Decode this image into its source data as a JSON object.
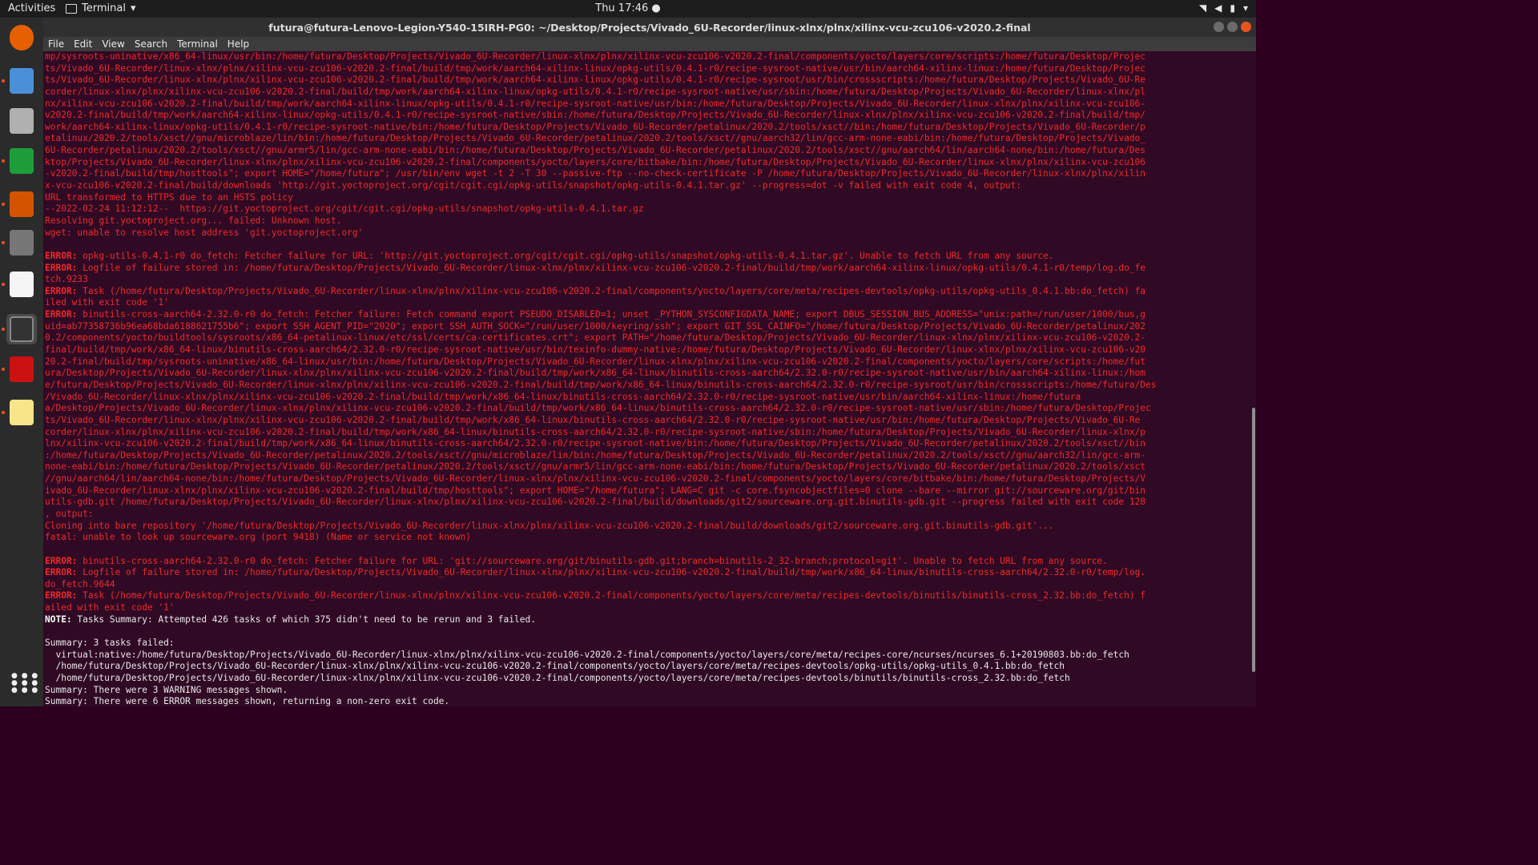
{
  "topbar": {
    "activities": "Activities",
    "app_name": "Terminal",
    "clock": "Thu 17:46"
  },
  "window": {
    "title": "futura@futura-Lenovo-Legion-Y540-15IRH-PG0: ~/Desktop/Projects/Vivado_6U-Recorder/linux-xlnx/plnx/xilinx-vcu-zcu106-v2020.2-final"
  },
  "menu": {
    "file": "File",
    "edit": "Edit",
    "view": "View",
    "search": "Search",
    "terminal": "Terminal",
    "help": "Help"
  },
  "dock": [
    {
      "name": "firefox-icon",
      "color": "#e66000"
    },
    {
      "name": "text-editor-icon",
      "color": "#4a90d9"
    },
    {
      "name": "files-icon",
      "color": "#b0b0b0"
    },
    {
      "name": "spreadsheet-icon",
      "color": "#1e9e3a"
    },
    {
      "name": "presentation-icon",
      "color": "#d35400"
    },
    {
      "name": "settings-icon",
      "color": "#777777"
    },
    {
      "name": "notes-icon",
      "color": "#f5f5f5"
    },
    {
      "name": "terminal-icon",
      "color": "#333333"
    },
    {
      "name": "evince-icon",
      "color": "#cc1111"
    },
    {
      "name": "sticky-notes-icon",
      "color": "#f7e58a"
    }
  ],
  "terminal": {
    "lines": [
      {
        "t": "mp/sysroots-uninative/x86_64-linux/usr/bin:/home/futura/Desktop/Projects/Vivado_6U-Recorder/linux-xlnx/plnx/xilinx-vcu-zcu106-v2020.2-final/components/yocto/layers/core/scripts:/home/futura/Desktop/Projec",
        "c": "red"
      },
      {
        "t": "ts/Vivado_6U-Recorder/linux-xlnx/plnx/xilinx-vcu-zcu106-v2020.2-final/build/tmp/work/aarch64-xilinx-linux/opkg-utils/0.4.1-r0/recipe-sysroot-native/usr/bin/aarch64-xilinx-linux:/home/futura/Desktop/Projec",
        "c": "red"
      },
      {
        "t": "ts/Vivado_6U-Recorder/linux-xlnx/plnx/xilinx-vcu-zcu106-v2020.2-final/build/tmp/work/aarch64-xilinx-linux/opkg-utils/0.4.1-r0/recipe-sysroot/usr/bin/crossscripts:/home/futura/Desktop/Projects/Vivado_6U-Re",
        "c": "red"
      },
      {
        "t": "corder/linux-xlnx/plnx/xilinx-vcu-zcu106-v2020.2-final/build/tmp/work/aarch64-xilinx-linux/opkg-utils/0.4.1-r0/recipe-sysroot-native/usr/sbin:/home/futura/Desktop/Projects/Vivado_6U-Recorder/linux-xlnx/pl",
        "c": "red"
      },
      {
        "t": "nx/xilinx-vcu-zcu106-v2020.2-final/build/tmp/work/aarch64-xilinx-linux/opkg-utils/0.4.1-r0/recipe-sysroot-native/usr/bin:/home/futura/Desktop/Projects/Vivado_6U-Recorder/linux-xlnx/plnx/xilinx-vcu-zcu106-",
        "c": "red"
      },
      {
        "t": "v2020.2-final/build/tmp/work/aarch64-xilinx-linux/opkg-utils/0.4.1-r0/recipe-sysroot-native/sbin:/home/futura/Desktop/Projects/Vivado_6U-Recorder/linux-xlnx/plnx/xilinx-vcu-zcu106-v2020.2-final/build/tmp/",
        "c": "red"
      },
      {
        "t": "work/aarch64-xilinx-linux/opkg-utils/0.4.1-r0/recipe-sysroot-native/bin:/home/futura/Desktop/Projects/Vivado_6U-Recorder/petalinux/2020.2/tools/xsct//bin:/home/futura/Desktop/Projects/Vivado_6U-Recorder/p",
        "c": "red"
      },
      {
        "t": "etalinux/2020.2/tools/xsct//gnu/microblaze/lin/bin:/home/futura/Desktop/Projects/Vivado_6U-Recorder/petalinux/2020.2/tools/xsct//gnu/aarch32/lin/gcc-arm-none-eabi/bin:/home/futura/Desktop/Projects/Vivado_",
        "c": "red"
      },
      {
        "t": "6U-Recorder/petalinux/2020.2/tools/xsct//gnu/armr5/lin/gcc-arm-none-eabi/bin:/home/futura/Desktop/Projects/Vivado_6U-Recorder/petalinux/2020.2/tools/xsct//gnu/aarch64/lin/aarch64-none/bin:/home/futura/Des",
        "c": "red"
      },
      {
        "t": "ktop/Projects/Vivado_6U-Recorder/linux-xlnx/plnx/xilinx-vcu-zcu106-v2020.2-final/components/yocto/layers/core/bitbake/bin:/home/futura/Desktop/Projects/Vivado_6U-Recorder/linux-xlnx/plnx/xilinx-vcu-zcu106",
        "c": "red"
      },
      {
        "t": "-v2020.2-final/build/tmp/hosttools\"; export HOME=\"/home/futura\"; /usr/bin/env wget -t 2 -T 30 --passive-ftp --no-check-certificate -P /home/futura/Desktop/Projects/Vivado_6U-Recorder/linux-xlnx/plnx/xilin",
        "c": "red"
      },
      {
        "t": "x-vcu-zcu106-v2020.2-final/build/downloads 'http://git.yoctoproject.org/cgit/cgit.cgi/opkg-utils/snapshot/opkg-utils-0.4.1.tar.gz' --progress=dot -v failed with exit code 4, output:",
        "c": "red"
      },
      {
        "t": "URL transformed to HTTPS due to an HSTS policy",
        "c": "red"
      },
      {
        "t": "--2022-02-24 11:12:12--  https://git.yoctoproject.org/cgit/cgit.cgi/opkg-utils/snapshot/opkg-utils-0.4.1.tar.gz",
        "c": "red"
      },
      {
        "t": "Resolving git.yoctoproject.org... failed: Unknown host.",
        "c": "red"
      },
      {
        "t": "wget: unable to resolve host address 'git.yoctoproject.org'",
        "c": "red"
      },
      {
        "t": "",
        "c": "red"
      },
      {
        "p": "ERROR:",
        "t": " opkg-utils-0.4.1-r0 do_fetch: Fetcher failure for URL: 'http://git.yoctoproject.org/cgit/cgit.cgi/opkg-utils/snapshot/opkg-utils-0.4.1.tar.gz'. Unable to fetch URL from any source.",
        "c": "red"
      },
      {
        "p": "ERROR:",
        "t": " Logfile of failure stored in: /home/futura/Desktop/Projects/Vivado_6U-Recorder/linux-xlnx/plnx/xilinx-vcu-zcu106-v2020.2-final/build/tmp/work/aarch64-xilinx-linux/opkg-utils/0.4.1-r0/temp/log.do_fe",
        "c": "red"
      },
      {
        "t": "tch.9233",
        "c": "red"
      },
      {
        "p": "ERROR:",
        "t": " Task (/home/futura/Desktop/Projects/Vivado_6U-Recorder/linux-xlnx/plnx/xilinx-vcu-zcu106-v2020.2-final/components/yocto/layers/core/meta/recipes-devtools/opkg-utils/opkg-utils_0.4.1.bb:do_fetch) fa",
        "c": "red"
      },
      {
        "t": "iled with exit code '1'",
        "c": "red"
      },
      {
        "p": "ERROR:",
        "t": " binutils-cross-aarch64-2.32.0-r0 do_fetch: Fetcher failure: Fetch command export PSEUDO_DISABLED=1; unset _PYTHON_SYSCONFIGDATA_NAME; export DBUS_SESSION_BUS_ADDRESS=\"unix:path=/run/user/1000/bus,g",
        "c": "red"
      },
      {
        "t": "uid=ab77358736b96ea68bda6188621755b6\"; export SSH_AGENT_PID=\"2020\"; export SSH_AUTH_SOCK=\"/run/user/1000/keyring/ssh\"; export GIT_SSL_CAINFO=\"/home/futura/Desktop/Projects/Vivado_6U-Recorder/petalinux/202",
        "c": "red"
      },
      {
        "t": "0.2/components/yocto/buildtools/sysroots/x86_64-petalinux-linux/etc/ssl/certs/ca-certificates.crt\"; export PATH=\"/home/futura/Desktop/Projects/Vivado_6U-Recorder/linux-xlnx/plnx/xilinx-vcu-zcu106-v2020.2-",
        "c": "red"
      },
      {
        "t": "final/build/tmp/work/x86_64-linux/binutils-cross-aarch64/2.32.0-r0/recipe-sysroot-native/usr/bin/texinfo-dummy-native:/home/futura/Desktop/Projects/Vivado_6U-Recorder/linux-xlnx/plnx/xilinx-vcu-zcu106-v20",
        "c": "red"
      },
      {
        "t": "20.2-final/build/tmp/sysroots-uninative/x86_64-linux/usr/bin:/home/futura/Desktop/Projects/Vivado_6U-Recorder/linux-xlnx/plnx/xilinx-vcu-zcu106-v2020.2-final/components/yocto/layers/core/scripts:/home/fut",
        "c": "red"
      },
      {
        "t": "ura/Desktop/Projects/Vivado_6U-Recorder/linux-xlnx/plnx/xilinx-vcu-zcu106-v2020.2-final/build/tmp/work/x86_64-linux/binutils-cross-aarch64/2.32.0-r0/recipe-sysroot-native/usr/bin/aarch64-xilinx-linux:/hom",
        "c": "red"
      },
      {
        "t": "e/futura/Desktop/Projects/Vivado_6U-Recorder/linux-xlnx/plnx/xilinx-vcu-zcu106-v2020.2-final/build/tmp/work/x86_64-linux/binutils-cross-aarch64/2.32.0-r0/recipe-sysroot/usr/bin/crossscripts:/home/futura/Des",
        "c": "red"
      },
      {
        "t": "/Vivado_6U-Recorder/linux-xlnx/plnx/xilinx-vcu-zcu106-v2020.2-final/build/tmp/work/x86_64-linux/binutils-cross-aarch64/2.32.0-r0/recipe-sysroot-native/usr/bin/aarch64-xilinx-linux:/home/futura",
        "c": "red"
      },
      {
        "t": "a/Desktop/Projects/Vivado_6U-Recorder/linux-xlnx/plnx/xilinx-vcu-zcu106-v2020.2-final/build/tmp/work/x86_64-linux/binutils-cross-aarch64/2.32.0-r0/recipe-sysroot-native/usr/sbin:/home/futura/Desktop/Projec",
        "c": "red"
      },
      {
        "t": "ts/Vivado_6U-Recorder/linux-xlnx/plnx/xilinx-vcu-zcu106-v2020.2-final/build/tmp/work/x86_64-linux/binutils-cross-aarch64/2.32.0-r0/recipe-sysroot-native/usr/bin:/home/futura/Desktop/Projects/Vivado_6U-Re",
        "c": "red"
      },
      {
        "t": "corder/linux-xlnx/plnx/xilinx-vcu-zcu106-v2020.2-final/build/tmp/work/x86_64-linux/binutils-cross-aarch64/2.32.0-r0/recipe-sysroot-native/sbin:/home/futura/Desktop/Projects/Vivado_6U-Recorder/linux-xlnx/p",
        "c": "red"
      },
      {
        "t": "lnx/xilinx-vcu-zcu106-v2020.2-final/build/tmp/work/x86_64-linux/binutils-cross-aarch64/2.32.0-r0/recipe-sysroot-native/bin:/home/futura/Desktop/Projects/Vivado_6U-Recorder/petalinux/2020.2/tools/xsct//bin",
        "c": "red"
      },
      {
        "t": ":/home/futura/Desktop/Projects/Vivado_6U-Recorder/petalinux/2020.2/tools/xsct//gnu/microblaze/lin/bin:/home/futura/Desktop/Projects/Vivado_6U-Recorder/petalinux/2020.2/tools/xsct//gnu/aarch32/lin/gcc-arm-",
        "c": "red"
      },
      {
        "t": "none-eabi/bin:/home/futura/Desktop/Projects/Vivado_6U-Recorder/petalinux/2020.2/tools/xsct//gnu/armr5/lin/gcc-arm-none-eabi/bin:/home/futura/Desktop/Projects/Vivado_6U-Recorder/petalinux/2020.2/tools/xsct",
        "c": "red"
      },
      {
        "t": "//gnu/aarch64/lin/aarch64-none/bin:/home/futura/Desktop/Projects/Vivado_6U-Recorder/linux-xlnx/plnx/xilinx-vcu-zcu106-v2020.2-final/components/yocto/layers/core/bitbake/bin:/home/futura/Desktop/Projects/V",
        "c": "red"
      },
      {
        "t": "ivado_6U-Recorder/linux-xlnx/plnx/xilinx-vcu-zcu106-v2020.2-final/build/tmp/hosttools\"; export HOME=\"/home/futura\"; LANG=C git -c core.fsyncobjectfiles=0 clone --bare --mirror git://sourceware.org/git/bin",
        "c": "red"
      },
      {
        "t": "utils-gdb.git /home/futura/Desktop/Projects/Vivado_6U-Recorder/linux-xlnx/plnx/xilinx-vcu-zcu106-v2020.2-final/build/downloads/git2/sourceware.org.git.binutils-gdb.git --progress failed with exit code 128",
        "c": "red"
      },
      {
        "t": ", output:",
        "c": "red"
      },
      {
        "t": "Cloning into bare repository '/home/futura/Desktop/Projects/Vivado_6U-Recorder/linux-xlnx/plnx/xilinx-vcu-zcu106-v2020.2-final/build/downloads/git2/sourceware.org.git.binutils-gdb.git'...",
        "c": "red"
      },
      {
        "t": "fatal: unable to look up sourceware.org (port 9418) (Name or service not known)",
        "c": "red"
      },
      {
        "t": "",
        "c": "red"
      },
      {
        "p": "ERROR:",
        "t": " binutils-cross-aarch64-2.32.0-r0 do_fetch: Fetcher failure for URL: 'git://sourceware.org/git/binutils-gdb.git;branch=binutils-2_32-branch;protocol=git'. Unable to fetch URL from any source.",
        "c": "red"
      },
      {
        "p": "ERROR:",
        "t": " Logfile of failure stored in: /home/futura/Desktop/Projects/Vivado_6U-Recorder/linux-xlnx/plnx/xilinx-vcu-zcu106-v2020.2-final/build/tmp/work/x86_64-linux/binutils-cross-aarch64/2.32.0-r0/temp/log.",
        "c": "red"
      },
      {
        "t": "do_fetch.9644",
        "c": "red"
      },
      {
        "p": "ERROR:",
        "t": " Task (/home/futura/Desktop/Projects/Vivado_6U-Recorder/linux-xlnx/plnx/xilinx-vcu-zcu106-v2020.2-final/components/yocto/layers/core/meta/recipes-devtools/binutils/binutils-cross_2.32.bb:do_fetch) f",
        "c": "red"
      },
      {
        "t": "ailed with exit code '1'",
        "c": "red"
      },
      {
        "p": "NOTE:",
        "t": " Tasks Summary: Attempted 426 tasks of which 375 didn't need to be rerun and 3 failed.",
        "c": "white",
        "pc": "note"
      },
      {
        "t": "",
        "c": "white"
      },
      {
        "t": "Summary: 3 tasks failed:",
        "c": "white"
      },
      {
        "t": "  virtual:native:/home/futura/Desktop/Projects/Vivado_6U-Recorder/linux-xlnx/plnx/xilinx-vcu-zcu106-v2020.2-final/components/yocto/layers/core/meta/recipes-core/ncurses/ncurses_6.1+20190803.bb:do_fetch",
        "c": "white"
      },
      {
        "t": "  /home/futura/Desktop/Projects/Vivado_6U-Recorder/linux-xlnx/plnx/xilinx-vcu-zcu106-v2020.2-final/components/yocto/layers/core/meta/recipes-devtools/opkg-utils/opkg-utils_0.4.1.bb:do_fetch",
        "c": "white"
      },
      {
        "t": "  /home/futura/Desktop/Projects/Vivado_6U-Recorder/linux-xlnx/plnx/xilinx-vcu-zcu106-v2020.2-final/components/yocto/layers/core/meta/recipes-devtools/binutils/binutils-cross_2.32.bb:do_fetch",
        "c": "white"
      },
      {
        "t": "Summary: There were 3 WARNING messages shown.",
        "c": "white"
      },
      {
        "t": "Summary: There were 6 ERROR messages shown, returning a non-zero exit code.",
        "c": "white"
      }
    ]
  }
}
